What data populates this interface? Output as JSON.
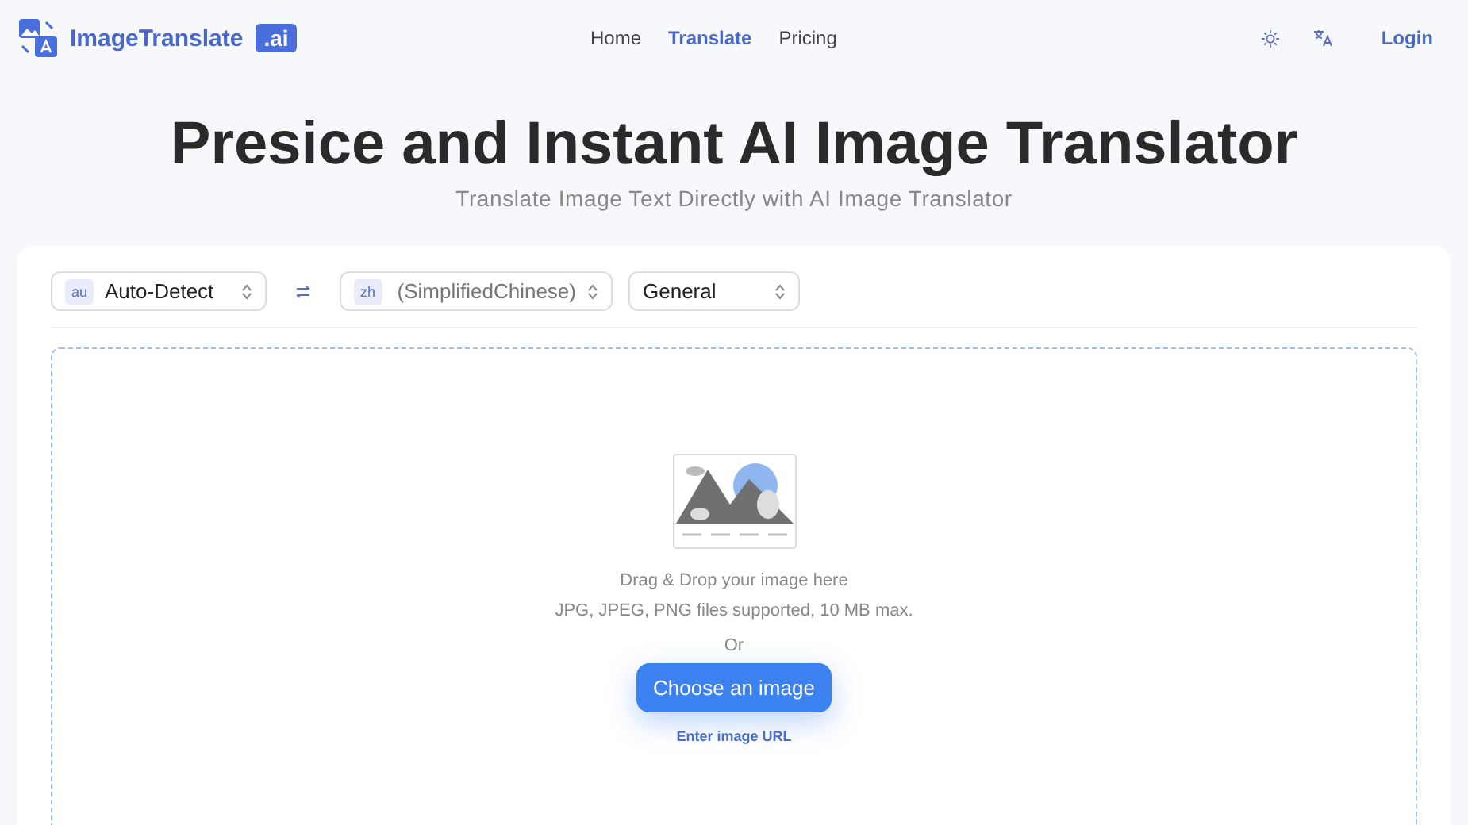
{
  "header": {
    "logo_text": "ImageTranslate",
    "logo_badge": ".ai",
    "nav": [
      {
        "label": "Home",
        "selected": false
      },
      {
        "label": "Translate",
        "selected": true
      },
      {
        "label": "Pricing",
        "selected": false
      }
    ],
    "login": "Login"
  },
  "hero": {
    "title": "Presice and Instant AI Image Translator",
    "subtitle": "Translate Image Text Directly with AI Image Translator"
  },
  "selectors": [
    {
      "kind": "language",
      "code": "au",
      "label": "Auto-Detect"
    },
    {
      "kind": "swap"
    },
    {
      "kind": "language",
      "code": "zh",
      "label": "(SimplifiedChinese)"
    },
    {
      "kind": "plain",
      "label": "General"
    }
  ],
  "dropzone": {
    "hint": "Drag & Drop your image here",
    "formats": "JPG, JPEG, PNG files supported, 10 MB max.",
    "or": "Or",
    "button": "Choose an image",
    "link": "Enter image URL"
  }
}
